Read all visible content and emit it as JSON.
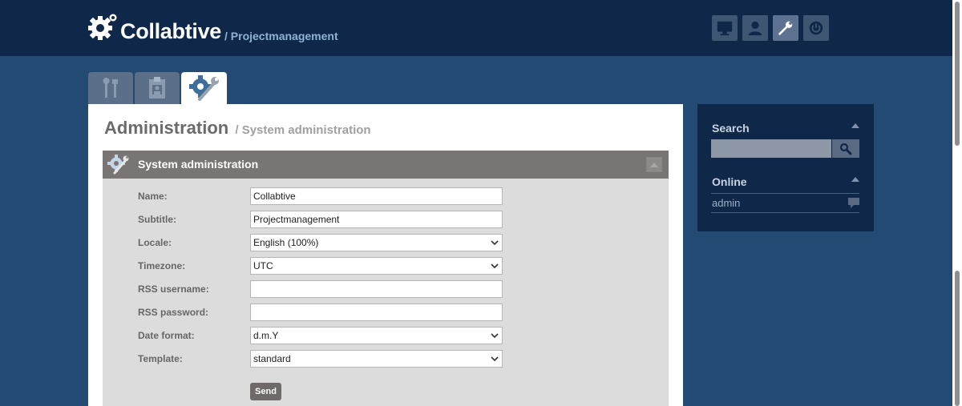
{
  "header": {
    "app_name": "Collabtive",
    "app_subtitle": "/ Projectmanagement",
    "nav_buttons": [
      {
        "name": "desktop",
        "icon": "monitor-icon"
      },
      {
        "name": "profile",
        "icon": "user-icon"
      },
      {
        "name": "administration",
        "icon": "wrench-icon"
      },
      {
        "name": "logout",
        "icon": "power-icon"
      }
    ]
  },
  "tabs": [
    {
      "name": "user-administration",
      "icon": "tools-icon"
    },
    {
      "name": "project-administration",
      "icon": "clipboard-icon"
    },
    {
      "name": "system-administration",
      "icon": "gears-icon",
      "active": true
    }
  ],
  "page": {
    "title": "Administration",
    "subtitle": "/ System administration"
  },
  "panel": {
    "title": "System administration",
    "fields": {
      "name": {
        "label": "Name:",
        "value": "Collabtive"
      },
      "subtitle": {
        "label": "Subtitle:",
        "value": "Projectmanagement"
      },
      "locale": {
        "label": "Locale:",
        "value": "English (100%)"
      },
      "timezone": {
        "label": "Timezone:",
        "value": "UTC"
      },
      "rss_username": {
        "label": "RSS username:",
        "value": ""
      },
      "rss_password": {
        "label": "RSS password:",
        "value": ""
      },
      "date_format": {
        "label": "Date format:",
        "value": "d.m.Y"
      },
      "template": {
        "label": "Template:",
        "value": "standard"
      }
    },
    "send_label": "Send"
  },
  "sidebar": {
    "search": {
      "title": "Search",
      "value": ""
    },
    "online": {
      "title": "Online",
      "users": [
        "admin"
      ]
    }
  },
  "colors": {
    "header_bg": "#0f2849",
    "page_bg": "#234a72",
    "block_header": "#797574",
    "block_bg": "#dcdcdc"
  }
}
